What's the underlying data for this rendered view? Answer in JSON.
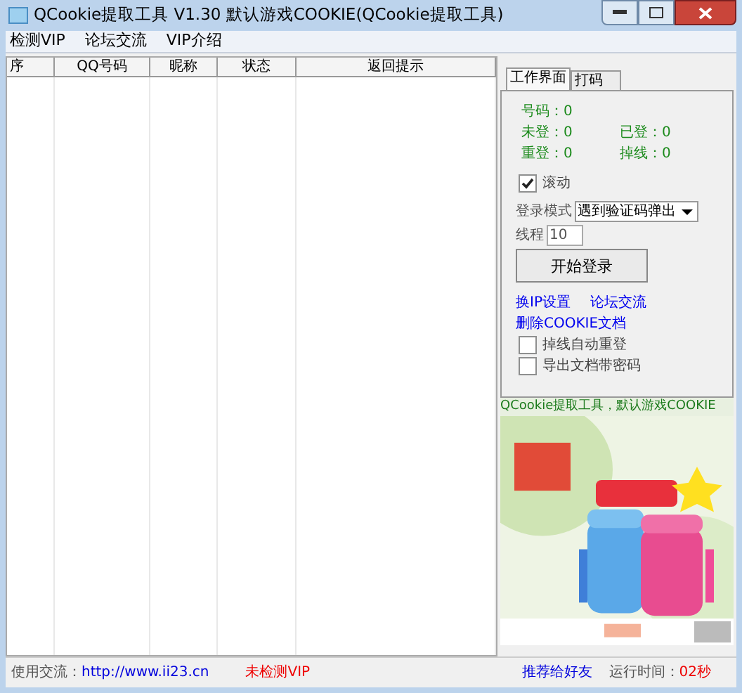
{
  "window": {
    "title": "QCookie提取工具 V1.30 默认游戏COOKIE(QCookie提取工具)"
  },
  "menu": [
    "检测VIP",
    "论坛交流",
    "VIP介绍"
  ],
  "table": {
    "columns": [
      "序",
      "QQ号码",
      "昵称",
      "状态",
      "返回提示"
    ]
  },
  "tabs": [
    {
      "label": "工作界面",
      "selected": true
    },
    {
      "label": "打码",
      "selected": false
    }
  ],
  "stats": [
    {
      "label": "号码：",
      "value": "0"
    },
    {
      "label": "未登：",
      "value": "0"
    },
    {
      "label": "已登：",
      "value": "0"
    },
    {
      "label": "重登：",
      "value": "0"
    },
    {
      "label": "掉线：",
      "value": "0"
    }
  ],
  "scroll": {
    "label": "滚动",
    "checked": true
  },
  "login_mode": {
    "label": "登录模式",
    "value": "遇到验证码弹出"
  },
  "threads": {
    "label": "线程",
    "value": "10"
  },
  "start_button": "开始登录",
  "links": [
    "换IP设置",
    "论坛交流",
    "删除COOKIE文档"
  ],
  "options": [
    {
      "label": "掉线自动重登",
      "checked": false
    },
    {
      "label": "导出文档带密码",
      "checked": false
    }
  ],
  "marquee": "QCookie提取工具，默认游戏COOKIE",
  "status_bar": {
    "contact_label": "使用交流：",
    "contact_url": "http://www.ii23.cn",
    "vip_status": "未检测VIP",
    "recommend": "推荐给好友",
    "runtime_label": "运行时间：",
    "runtime_value": "02秒"
  }
}
